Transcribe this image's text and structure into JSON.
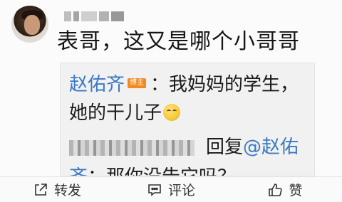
{
  "post": {
    "text": "表哥，这又是哪个小哥哥"
  },
  "comment": {
    "author": "赵佑齐",
    "badge": "博主",
    "reply_line1": "：我妈妈的学生，",
    "reply_line2": "她的干儿子",
    "reply_prefix": "回复",
    "mention": "@赵佑",
    "reply_line4_start": "齐",
    "reply_line4_rest": "：那你没告它吗？"
  },
  "actions": {
    "repost": "转发",
    "comment": "评论",
    "like": "赞"
  },
  "colors": {
    "link": "#3a78c3",
    "badge": "#f28a1e"
  }
}
